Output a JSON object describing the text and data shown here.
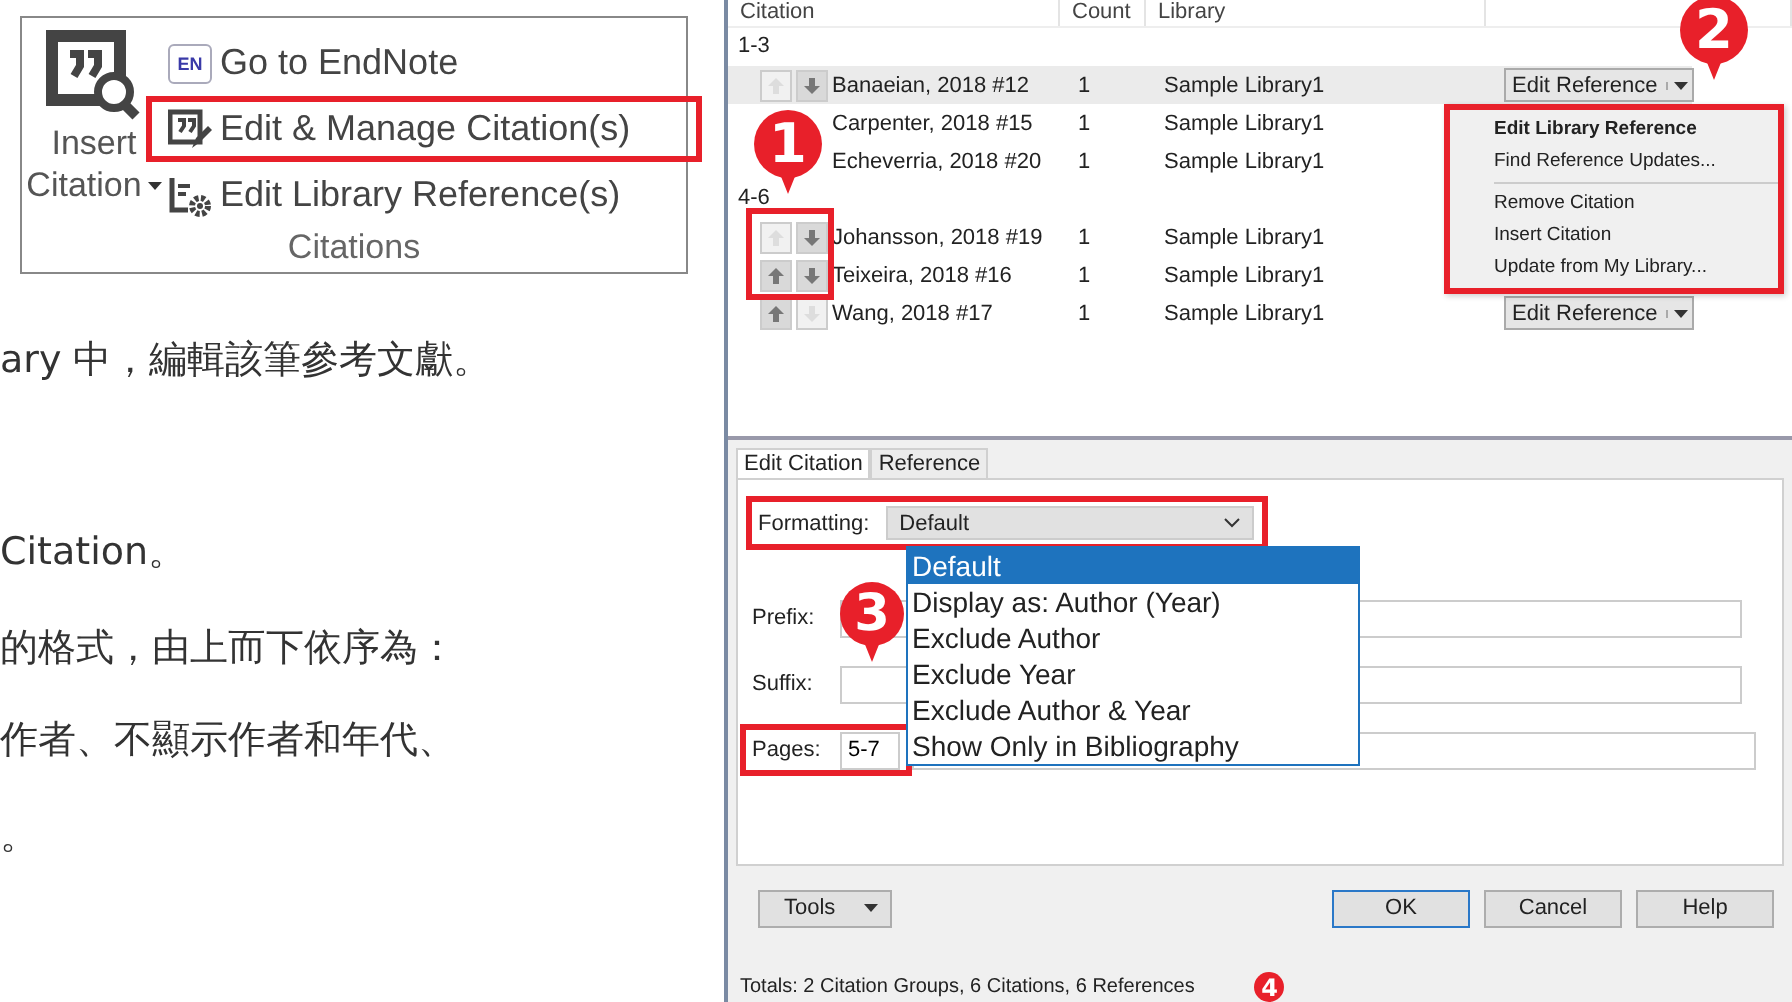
{
  "ribbon": {
    "insert": {
      "line1": "Insert",
      "line2": "Citation"
    },
    "items": [
      {
        "kind": "endnote",
        "icon_text": "EN",
        "label": "Go to EndNote",
        "highlighted": false
      },
      {
        "kind": "manage",
        "label": "Edit & Manage Citation(s)",
        "highlighted": true
      },
      {
        "kind": "library",
        "label": "Edit Library Reference(s)",
        "highlighted": false
      }
    ],
    "group_label": "Citations"
  },
  "instructions": [
    "ary 中，編輯該筆參考文獻。",
    "Citation。",
    "的格式，由上而下依序為：",
    "作者、不顯示作者和年代、",
    "。"
  ],
  "dialog": {
    "columns": [
      "Citation",
      "Count",
      "Library"
    ],
    "groups": [
      {
        "label": "1-3",
        "rows": [
          {
            "citation": "Banaeian, 2018 #12",
            "count": "1",
            "library": "Sample Library1",
            "selected": true,
            "arrows": {
              "up_enabled": false,
              "down_enabled": true
            },
            "button": "Edit Reference"
          },
          {
            "citation": "Carpenter, 2018 #15",
            "count": "1",
            "library": "Sample Library1",
            "selected": false
          },
          {
            "citation": "Echeverria, 2018 #20",
            "count": "1",
            "library": "Sample Library1",
            "selected": false
          }
        ]
      },
      {
        "label": "4-6",
        "rows": [
          {
            "citation": "Johansson, 2018 #19",
            "count": "1",
            "library": "Sample Library1",
            "selected": false,
            "arrows": {
              "up_enabled": false,
              "down_enabled": true
            }
          },
          {
            "citation": "Teixeira, 2018 #16",
            "count": "1",
            "library": "Sample Library1",
            "selected": false,
            "arrows": {
              "up_enabled": true,
              "down_enabled": true
            }
          },
          {
            "citation": "Wang, 2018 #17",
            "count": "1",
            "library": "Sample Library1",
            "selected": false,
            "arrows": {
              "up_enabled": true,
              "down_enabled": false
            },
            "button": "Edit Reference"
          }
        ]
      }
    ],
    "context_menu": {
      "highlighted": true,
      "items": [
        {
          "label": "Edit Library Reference",
          "bold": true,
          "separator_after": false
        },
        {
          "label": "Find Reference Updates...",
          "bold": false,
          "separator_after": true
        },
        {
          "label": "Remove Citation",
          "bold": false,
          "separator_after": false
        },
        {
          "label": "Insert Citation",
          "bold": false,
          "separator_after": false
        },
        {
          "label": "Update from My Library...",
          "bold": false,
          "separator_after": false
        }
      ]
    },
    "tabs": [
      {
        "label": "Edit Citation",
        "selected": true
      },
      {
        "label": "Reference",
        "selected": false
      }
    ],
    "formatting": {
      "label": "Formatting:",
      "value": "Default",
      "highlighted": true,
      "options": [
        {
          "label": "Default",
          "selected": true
        },
        {
          "label": "Display as: Author (Year)",
          "selected": false
        },
        {
          "label": "Exclude Author",
          "selected": false
        },
        {
          "label": "Exclude Year",
          "selected": false
        },
        {
          "label": "Exclude Author & Year",
          "selected": false
        },
        {
          "label": "Show Only in Bibliography",
          "selected": false
        }
      ]
    },
    "fields": [
      {
        "label": "Prefix:",
        "highlighted": false
      },
      {
        "label": "Suffix:",
        "highlighted": false
      },
      {
        "label": "Pages:",
        "value": "5-7",
        "highlighted": true
      }
    ],
    "tools": "Tools",
    "buttons": [
      {
        "label": "OK",
        "default": true
      },
      {
        "label": "Cancel",
        "default": false
      },
      {
        "label": "Help",
        "default": false
      }
    ],
    "status": "Totals: 2 Citation Groups, 6 Citations, 6 References"
  },
  "callouts": [
    "1",
    "2",
    "3",
    "4"
  ]
}
